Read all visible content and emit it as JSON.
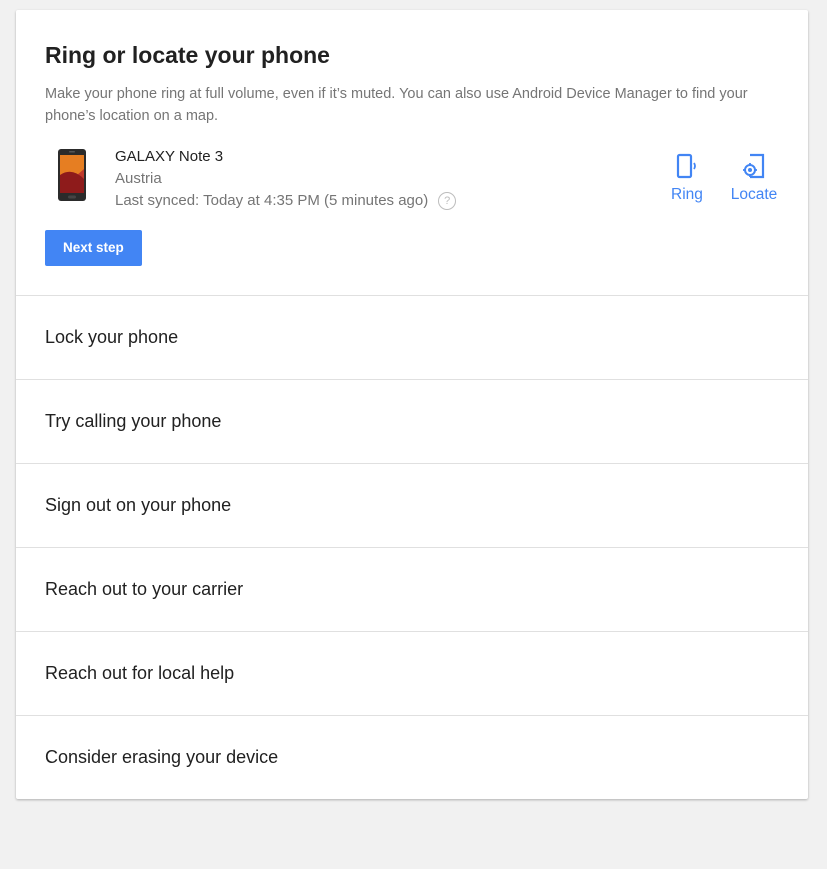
{
  "header": {
    "title": "Ring or locate your phone",
    "description": "Make your phone ring at full volume, even if it’s muted. You can also use Android Device Manager to find your phone’s location on a map."
  },
  "device": {
    "name": "GALAXY Note 3",
    "country": "Austria",
    "last_synced": "Last synced: Today at 4:35 PM (5 minutes ago)",
    "help_glyph": "?"
  },
  "actions": {
    "ring_label": "Ring",
    "locate_label": "Locate"
  },
  "next_step_label": "Next step",
  "steps": [
    {
      "label": "Lock your phone"
    },
    {
      "label": "Try calling your phone"
    },
    {
      "label": "Sign out on your phone"
    },
    {
      "label": "Reach out to your carrier"
    },
    {
      "label": "Reach out for local help"
    },
    {
      "label": "Consider erasing your device"
    }
  ],
  "colors": {
    "accent": "#4285f4",
    "background": "#f1f1f1",
    "card": "#ffffff",
    "text_primary": "#212121",
    "text_secondary": "#757575",
    "divider": "#e0e0e0"
  },
  "icons": {
    "phone_image": "phone-image",
    "ring": "ring-icon",
    "locate": "locate-icon",
    "help": "help-icon"
  }
}
